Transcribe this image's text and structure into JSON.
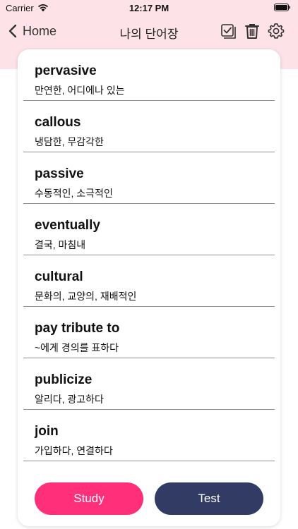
{
  "status": {
    "carrier": "Carrier",
    "time": "12:17 PM"
  },
  "nav": {
    "back_label": "Home",
    "title": "나의 단어장"
  },
  "words": [
    {
      "word": "pervasive",
      "meaning": "만연한, 어디에나 있는"
    },
    {
      "word": "callous",
      "meaning": "냉담한, 무감각한"
    },
    {
      "word": "passive",
      "meaning": "수동적인, 소극적인"
    },
    {
      "word": "eventually",
      "meaning": "결국, 마침내"
    },
    {
      "word": "cultural",
      "meaning": "문화의, 교양의, 재배적인"
    },
    {
      "word": "pay tribute to",
      "meaning": "~에게 경의를 표하다"
    },
    {
      "word": "publicize",
      "meaning": "알리다, 광고하다"
    },
    {
      "word": "join",
      "meaning": "가입하다, 연결하다"
    }
  ],
  "buttons": {
    "study_label": "Study",
    "test_label": "Test"
  },
  "colors": {
    "header_bg": "#fde3e8",
    "study": "#ff2f7a",
    "test": "#313b64"
  },
  "icons": [
    "back-chevron-icon",
    "checklist-icon",
    "trash-icon",
    "gear-icon",
    "wifi-icon",
    "battery-icon"
  ]
}
